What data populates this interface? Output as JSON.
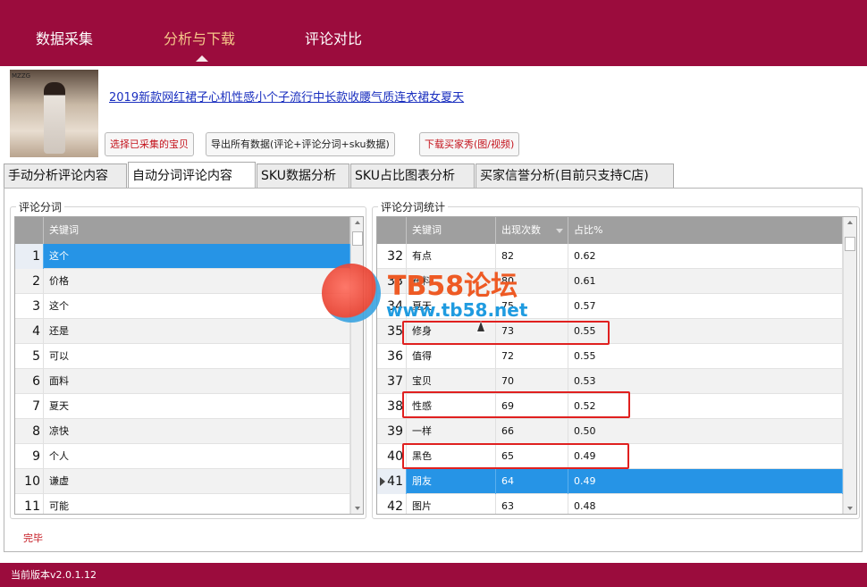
{
  "nav": {
    "items": [
      {
        "label": "数据采集"
      },
      {
        "label": "分析与下载"
      },
      {
        "label": "评论对比"
      }
    ],
    "active_index": 1
  },
  "product": {
    "image_tag": "MZZG",
    "title": "2019新款网红裙子心机性感小个子流行中长款收腰气质连衣裙女夏天"
  },
  "actions": {
    "select_label": "选择已采集的宝贝",
    "export_label": "导出所有数据(评论+评论分词+sku数据)",
    "download_label": "下载买家秀(图/视频)"
  },
  "tabs": [
    {
      "label": "手动分析评论内容"
    },
    {
      "label": "自动分词评论内容"
    },
    {
      "label": "SKU数据分析"
    },
    {
      "label": "SKU占比图表分析"
    },
    {
      "label": "买家信誉分析(目前只支持C店)"
    }
  ],
  "active_tab": 1,
  "left_group": {
    "label": "评论分词",
    "header": "关键词",
    "rows": [
      {
        "idx": "1",
        "kw": "这个"
      },
      {
        "idx": "2",
        "kw": "价格"
      },
      {
        "idx": "3",
        "kw": "这个"
      },
      {
        "idx": "4",
        "kw": "还是"
      },
      {
        "idx": "5",
        "kw": "可以"
      },
      {
        "idx": "6",
        "kw": "面料"
      },
      {
        "idx": "7",
        "kw": "夏天"
      },
      {
        "idx": "8",
        "kw": "凉快"
      },
      {
        "idx": "9",
        "kw": "个人"
      },
      {
        "idx": "10",
        "kw": "谦虚"
      },
      {
        "idx": "11",
        "kw": "可能"
      }
    ],
    "selected_index": 0
  },
  "right_group": {
    "label": "评论分词统计",
    "headers": {
      "kw": "关键词",
      "count": "出现次数",
      "pct": "占比%"
    },
    "rows": [
      {
        "idx": "32",
        "kw": "有点",
        "count": "82",
        "pct": "0.62"
      },
      {
        "idx": "33",
        "kw": "布料",
        "count": "80",
        "pct": "0.61"
      },
      {
        "idx": "34",
        "kw": "夏天",
        "count": "75",
        "pct": "0.57"
      },
      {
        "idx": "35",
        "kw": "修身",
        "count": "73",
        "pct": "0.55"
      },
      {
        "idx": "36",
        "kw": "值得",
        "count": "72",
        "pct": "0.55"
      },
      {
        "idx": "37",
        "kw": "宝贝",
        "count": "70",
        "pct": "0.53"
      },
      {
        "idx": "38",
        "kw": "性感",
        "count": "69",
        "pct": "0.52"
      },
      {
        "idx": "39",
        "kw": "一样",
        "count": "66",
        "pct": "0.50"
      },
      {
        "idx": "40",
        "kw": "黑色",
        "count": "65",
        "pct": "0.49"
      },
      {
        "idx": "41",
        "kw": "朋友",
        "count": "64",
        "pct": "0.49"
      },
      {
        "idx": "42",
        "kw": "图片",
        "count": "63",
        "pct": "0.48"
      }
    ],
    "selected_index": 9
  },
  "status": {
    "text": "完毕"
  },
  "footer": {
    "version": "当前版本v2.0.1.12"
  },
  "watermark": {
    "title": "TB58论坛",
    "url": "www.tb58.net"
  },
  "colors": {
    "brand": "#9b0c3d",
    "active_nav": "#f6c889",
    "selection": "#2694e6",
    "highlight": "#e0201f"
  }
}
